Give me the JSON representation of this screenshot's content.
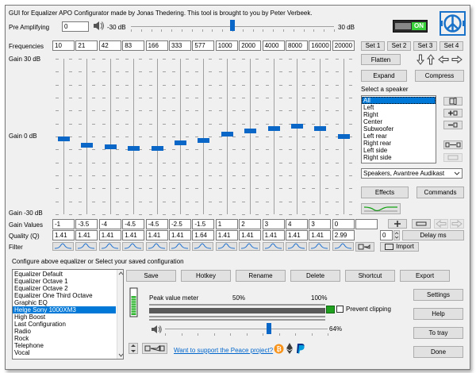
{
  "title": "GUI for Equalizer APO Configurator made by Jonas Thedering. This tool is brought to you by Peter Verbeek.",
  "preamp": {
    "label": "Pre Amplifying",
    "value": "0",
    "min_label": "-30 dB",
    "max_label": "30 dB",
    "level_db": 0
  },
  "power_switch": {
    "label": "ON",
    "on": true
  },
  "sets": [
    "Set 1",
    "Set 2",
    "Set 3",
    "Set 4"
  ],
  "labels": {
    "frequencies": "Frequencies",
    "gain_top": "Gain 30 dB",
    "gain_mid": "Gain 0 dB",
    "gain_bot": "Gain -30 dB",
    "gain_values": "Gain Values",
    "quality": "Quality (Q)",
    "filter": "Filter",
    "select_speaker": "Select a speaker",
    "configure": "Configure above equalizer or Select your saved configuration",
    "peak_meter": "Peak value meter",
    "pct50": "50%",
    "pct100": "100%",
    "prevent_clipping": "Prevent clipping",
    "volume_pct": "64%",
    "support_link": "Want to support the Peace project?"
  },
  "bands": [
    {
      "freq": "10",
      "gain": "-1",
      "q": "1.41"
    },
    {
      "freq": "21",
      "gain": "-3.5",
      "q": "1.41"
    },
    {
      "freq": "42",
      "gain": "-4",
      "q": "1.41"
    },
    {
      "freq": "83",
      "gain": "-4.5",
      "q": "1.41"
    },
    {
      "freq": "166",
      "gain": "-4.5",
      "q": "1.41"
    },
    {
      "freq": "333",
      "gain": "-2.5",
      "q": "1.41"
    },
    {
      "freq": "577",
      "gain": "-1.5",
      "q": "1.64"
    },
    {
      "freq": "1000",
      "gain": "1",
      "q": "1.41"
    },
    {
      "freq": "2000",
      "gain": "2",
      "q": "1.41"
    },
    {
      "freq": "4000",
      "gain": "3",
      "q": "1.41"
    },
    {
      "freq": "8000",
      "gain": "4",
      "q": "1.41"
    },
    {
      "freq": "16000",
      "gain": "3",
      "q": "1.41"
    },
    {
      "freq": "20000",
      "gain": "0",
      "q": "2.99"
    }
  ],
  "buttons": {
    "flatten": "Flatten",
    "expand": "Expand",
    "compress": "Compress",
    "effects": "Effects",
    "commands": "Commands",
    "delay": "Delay ms",
    "delay_value": "0",
    "import": "Import",
    "save": "Save",
    "hotkey": "Hotkey",
    "rename": "Rename",
    "delete": "Delete",
    "shortcut": "Shortcut",
    "export": "Export",
    "settings": "Settings",
    "help": "Help",
    "to_tray": "To tray",
    "done": "Done"
  },
  "speakers": {
    "items": [
      "All",
      "Left",
      "Right",
      "Center",
      "Subwoofer",
      "Left rear",
      "Right rear",
      "Left side",
      "Right side"
    ],
    "selected": 0,
    "device": "Speakers, Avantree Audikast"
  },
  "configs": {
    "items": [
      "Equalizer Default",
      "Equalizer Octave 1",
      "Equalizer Octave 2",
      "Equalizer One Third Octave",
      "Graphic EQ",
      "Helge Sony 1000XM3",
      "High Boost",
      "Last Configuration",
      "Radio",
      "Rock",
      "Telephone",
      "Vocal"
    ],
    "selected": 5
  },
  "volume": {
    "level": 0.64
  },
  "colors": {
    "accent": "#0a66c7",
    "selection": "#0078d7",
    "peace_blue": "#1a73c8",
    "switch_green": "#3ad23a"
  }
}
